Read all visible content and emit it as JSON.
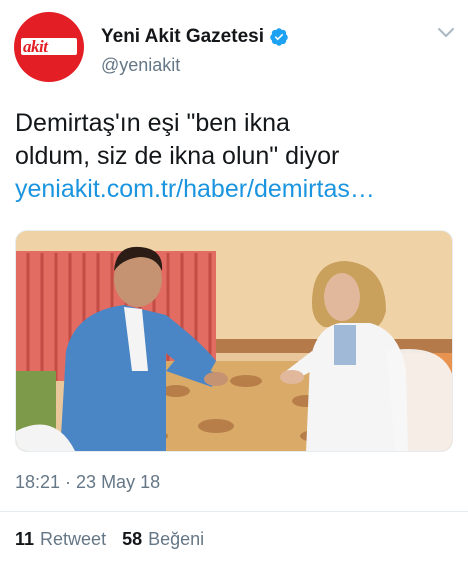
{
  "author": {
    "display_name": "Yeni Akit Gazetesi",
    "handle": "@yeniakit",
    "verified": true,
    "avatar_logo_text": "akit",
    "avatar_bg": "#e31e24"
  },
  "tweet": {
    "text_line1": "Demirtaş'ın eşi \"ben ikna",
    "text_line2": "oldum, siz de ikna olun\" diyor",
    "link_text": "yeniakit.com.tr/haber/demirtas…",
    "link_color": "#1b95e0",
    "timestamp": "18:21 · 23 May 18"
  },
  "stats": {
    "retweet_count": "11",
    "retweet_label": "Retweet",
    "like_count": "58",
    "like_label": "Beğeni"
  },
  "icons": {
    "verified": "verified-badge-icon",
    "caret": "chevron-down-icon"
  }
}
